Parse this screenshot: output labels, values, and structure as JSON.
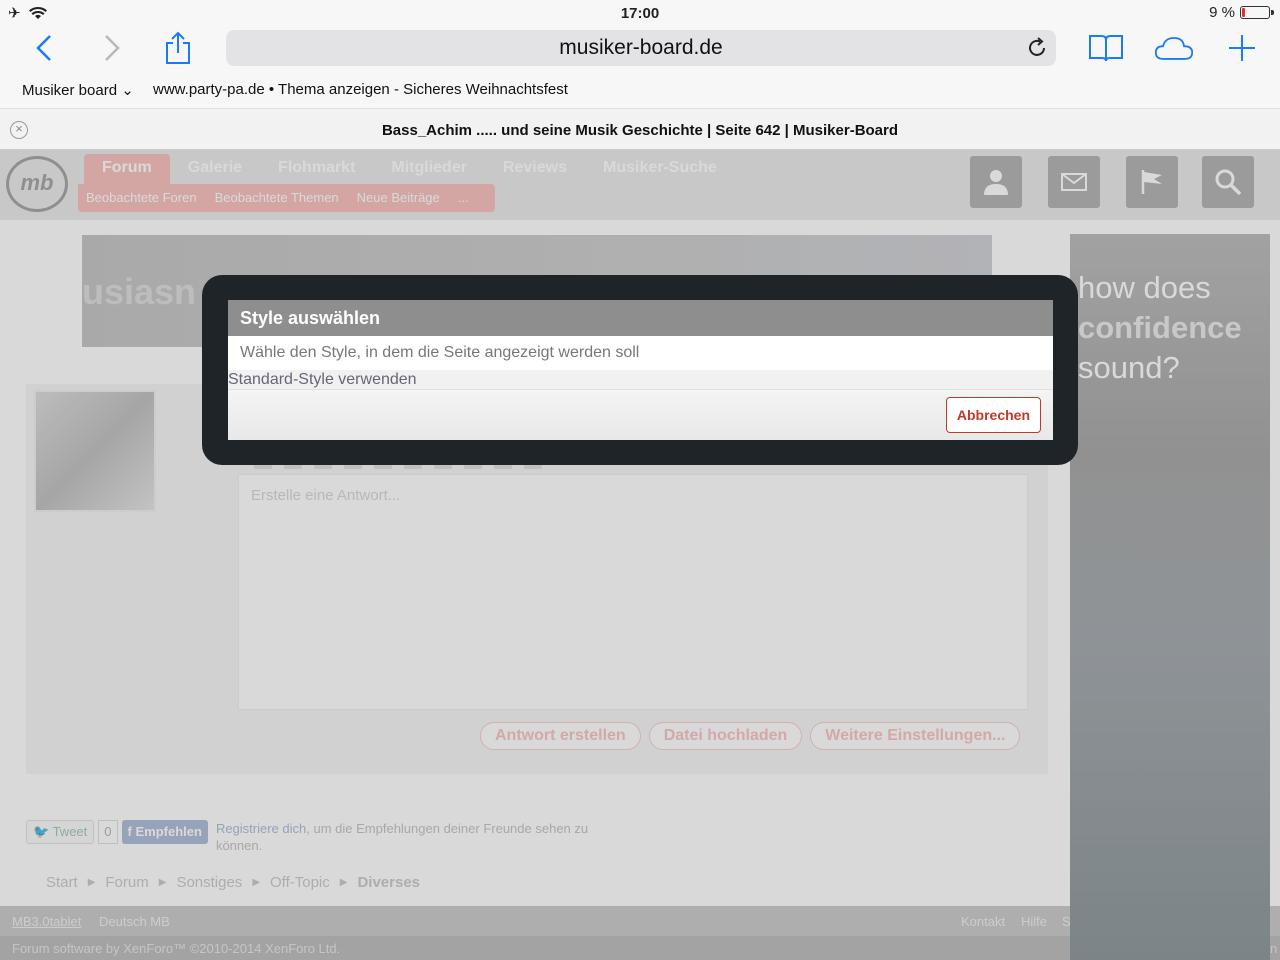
{
  "status": {
    "time": "17:00",
    "battery": "9 %",
    "battery_level": 0.09
  },
  "safari": {
    "url": "musiker-board.de"
  },
  "bookmarks": [
    "Musiker board ⌄",
    "www.party-pa.de • Thema anzeigen - Sicheres Weihnachtsfest"
  ],
  "tab": {
    "title": "Bass_Achim ..... und seine Musik Geschichte | Seite 642 | Musiker-Board"
  },
  "site": {
    "nav": [
      "Forum",
      "Galerie",
      "Flohmarkt",
      "Mitglieder",
      "Reviews",
      "Musiker-Suche"
    ],
    "subnav": [
      "Beobachtete Foren",
      "Beobachtete Themen",
      "Neue Beiträge",
      "..."
    ],
    "banner_word": "usiasn",
    "editor_placeholder": "Erstelle eine Antwort...",
    "actions": [
      "Antwort erstellen",
      "Datei hochladen",
      "Weitere Einstellungen..."
    ],
    "social": {
      "tweet": "Tweet",
      "count": "0",
      "fb": "Empfehlen",
      "desc_link": "Registriere dich",
      "desc_rest": ", um die Empfehlungen deiner Freunde sehen zu können."
    },
    "breadcrumbs": [
      "Start",
      "Forum",
      "Sonstiges",
      "Off-Topic",
      "Diverses"
    ],
    "footer": {
      "style": "MB3.0tablet",
      "lang": "Deutsch MB",
      "contact": "Kontakt",
      "help": "Hilfe",
      "s": "S",
      "copyright": "Forum software by XenForo™ ©2010-2014 XenForo Ltd.",
      "n": "n"
    },
    "ad": {
      "l1": "how does",
      "l2": "confidence",
      "l3": "sound?"
    }
  },
  "modal": {
    "title": "Style auswählen",
    "description": "Wähle den Style, in dem die Seite angezeigt werden soll",
    "option": "Standard-Style verwenden",
    "cancel": "Abbrechen"
  }
}
